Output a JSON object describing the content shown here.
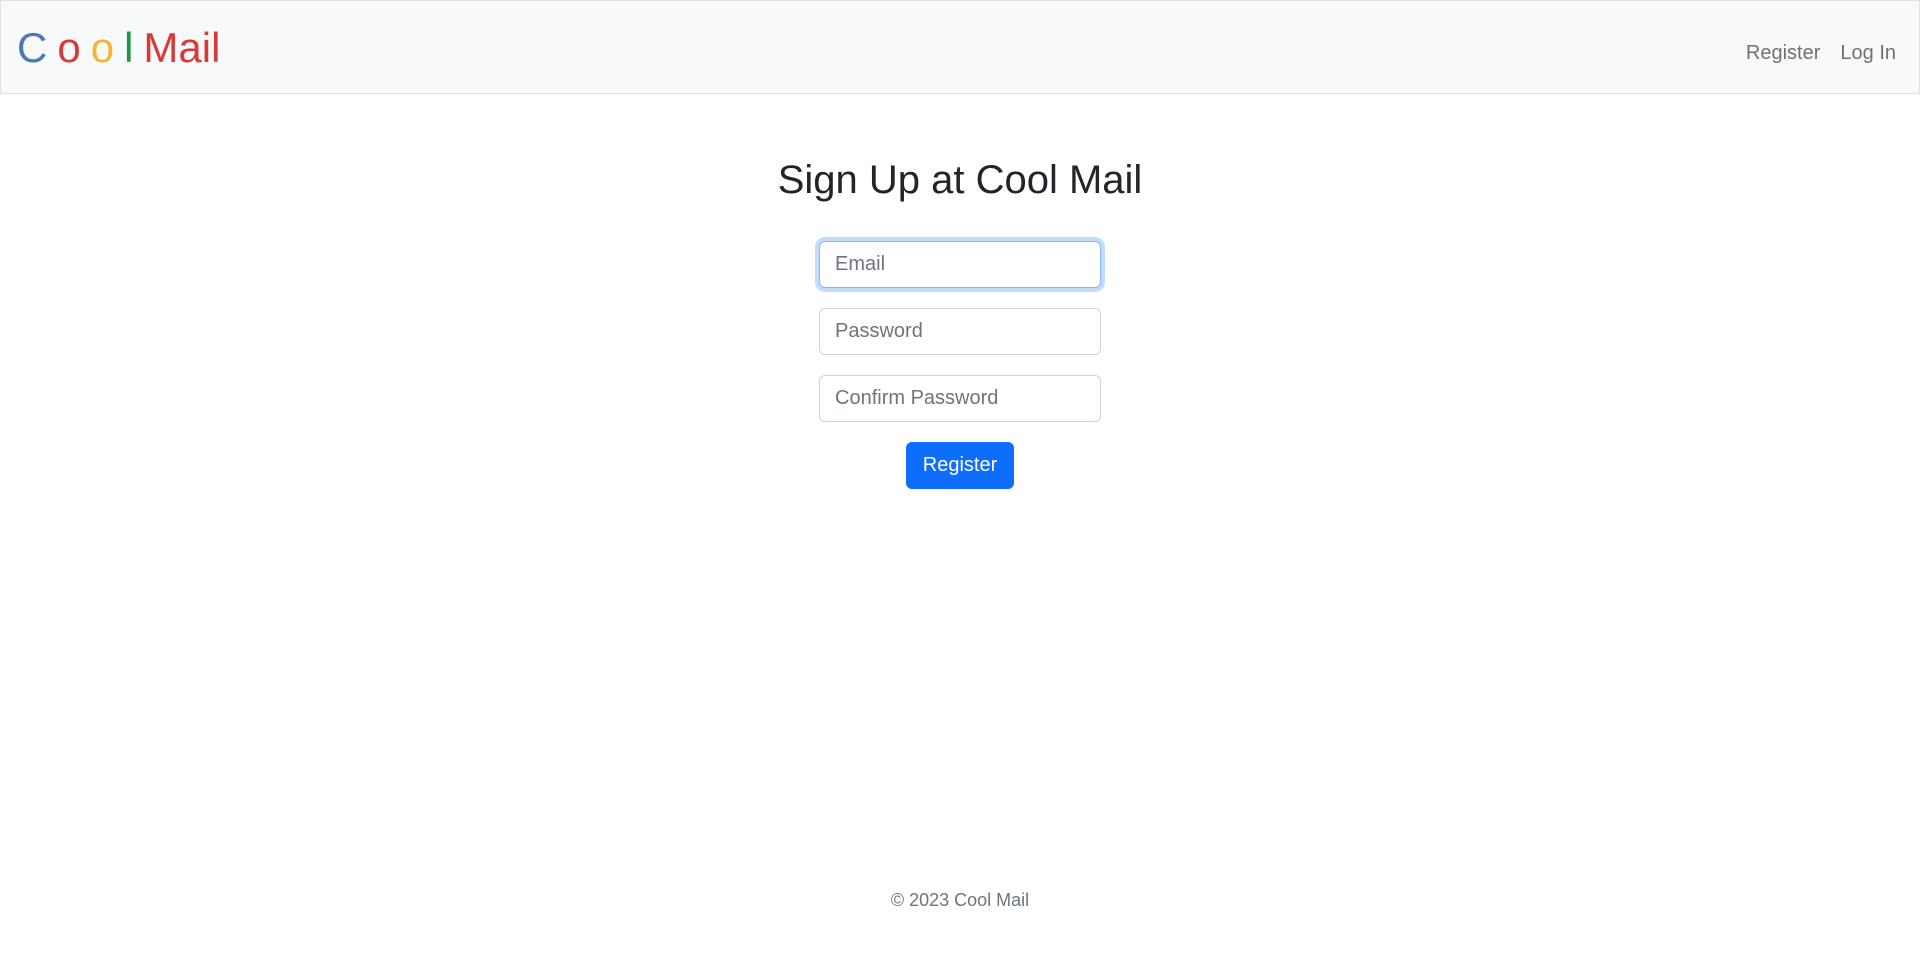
{
  "brand": {
    "letters": [
      {
        "char": "C",
        "color": "#4a7ab8"
      },
      {
        "char": "o",
        "color": "#d93a37"
      },
      {
        "char": "o",
        "color": "#f2b632"
      },
      {
        "char": "l",
        "color": "#1f9347"
      },
      {
        "char": "Mail",
        "color": "#d93a37"
      }
    ]
  },
  "nav": {
    "register_label": "Register",
    "login_label": "Log In"
  },
  "main": {
    "title": "Sign Up at Cool Mail",
    "email_placeholder": "Email",
    "password_placeholder": "Password",
    "confirm_placeholder": "Confirm Password",
    "submit_label": "Register"
  },
  "footer": {
    "text": "© 2023 Cool Mail"
  },
  "colors": {
    "primary": "#0d6efd",
    "navbar_bg": "#f8f9fa"
  }
}
